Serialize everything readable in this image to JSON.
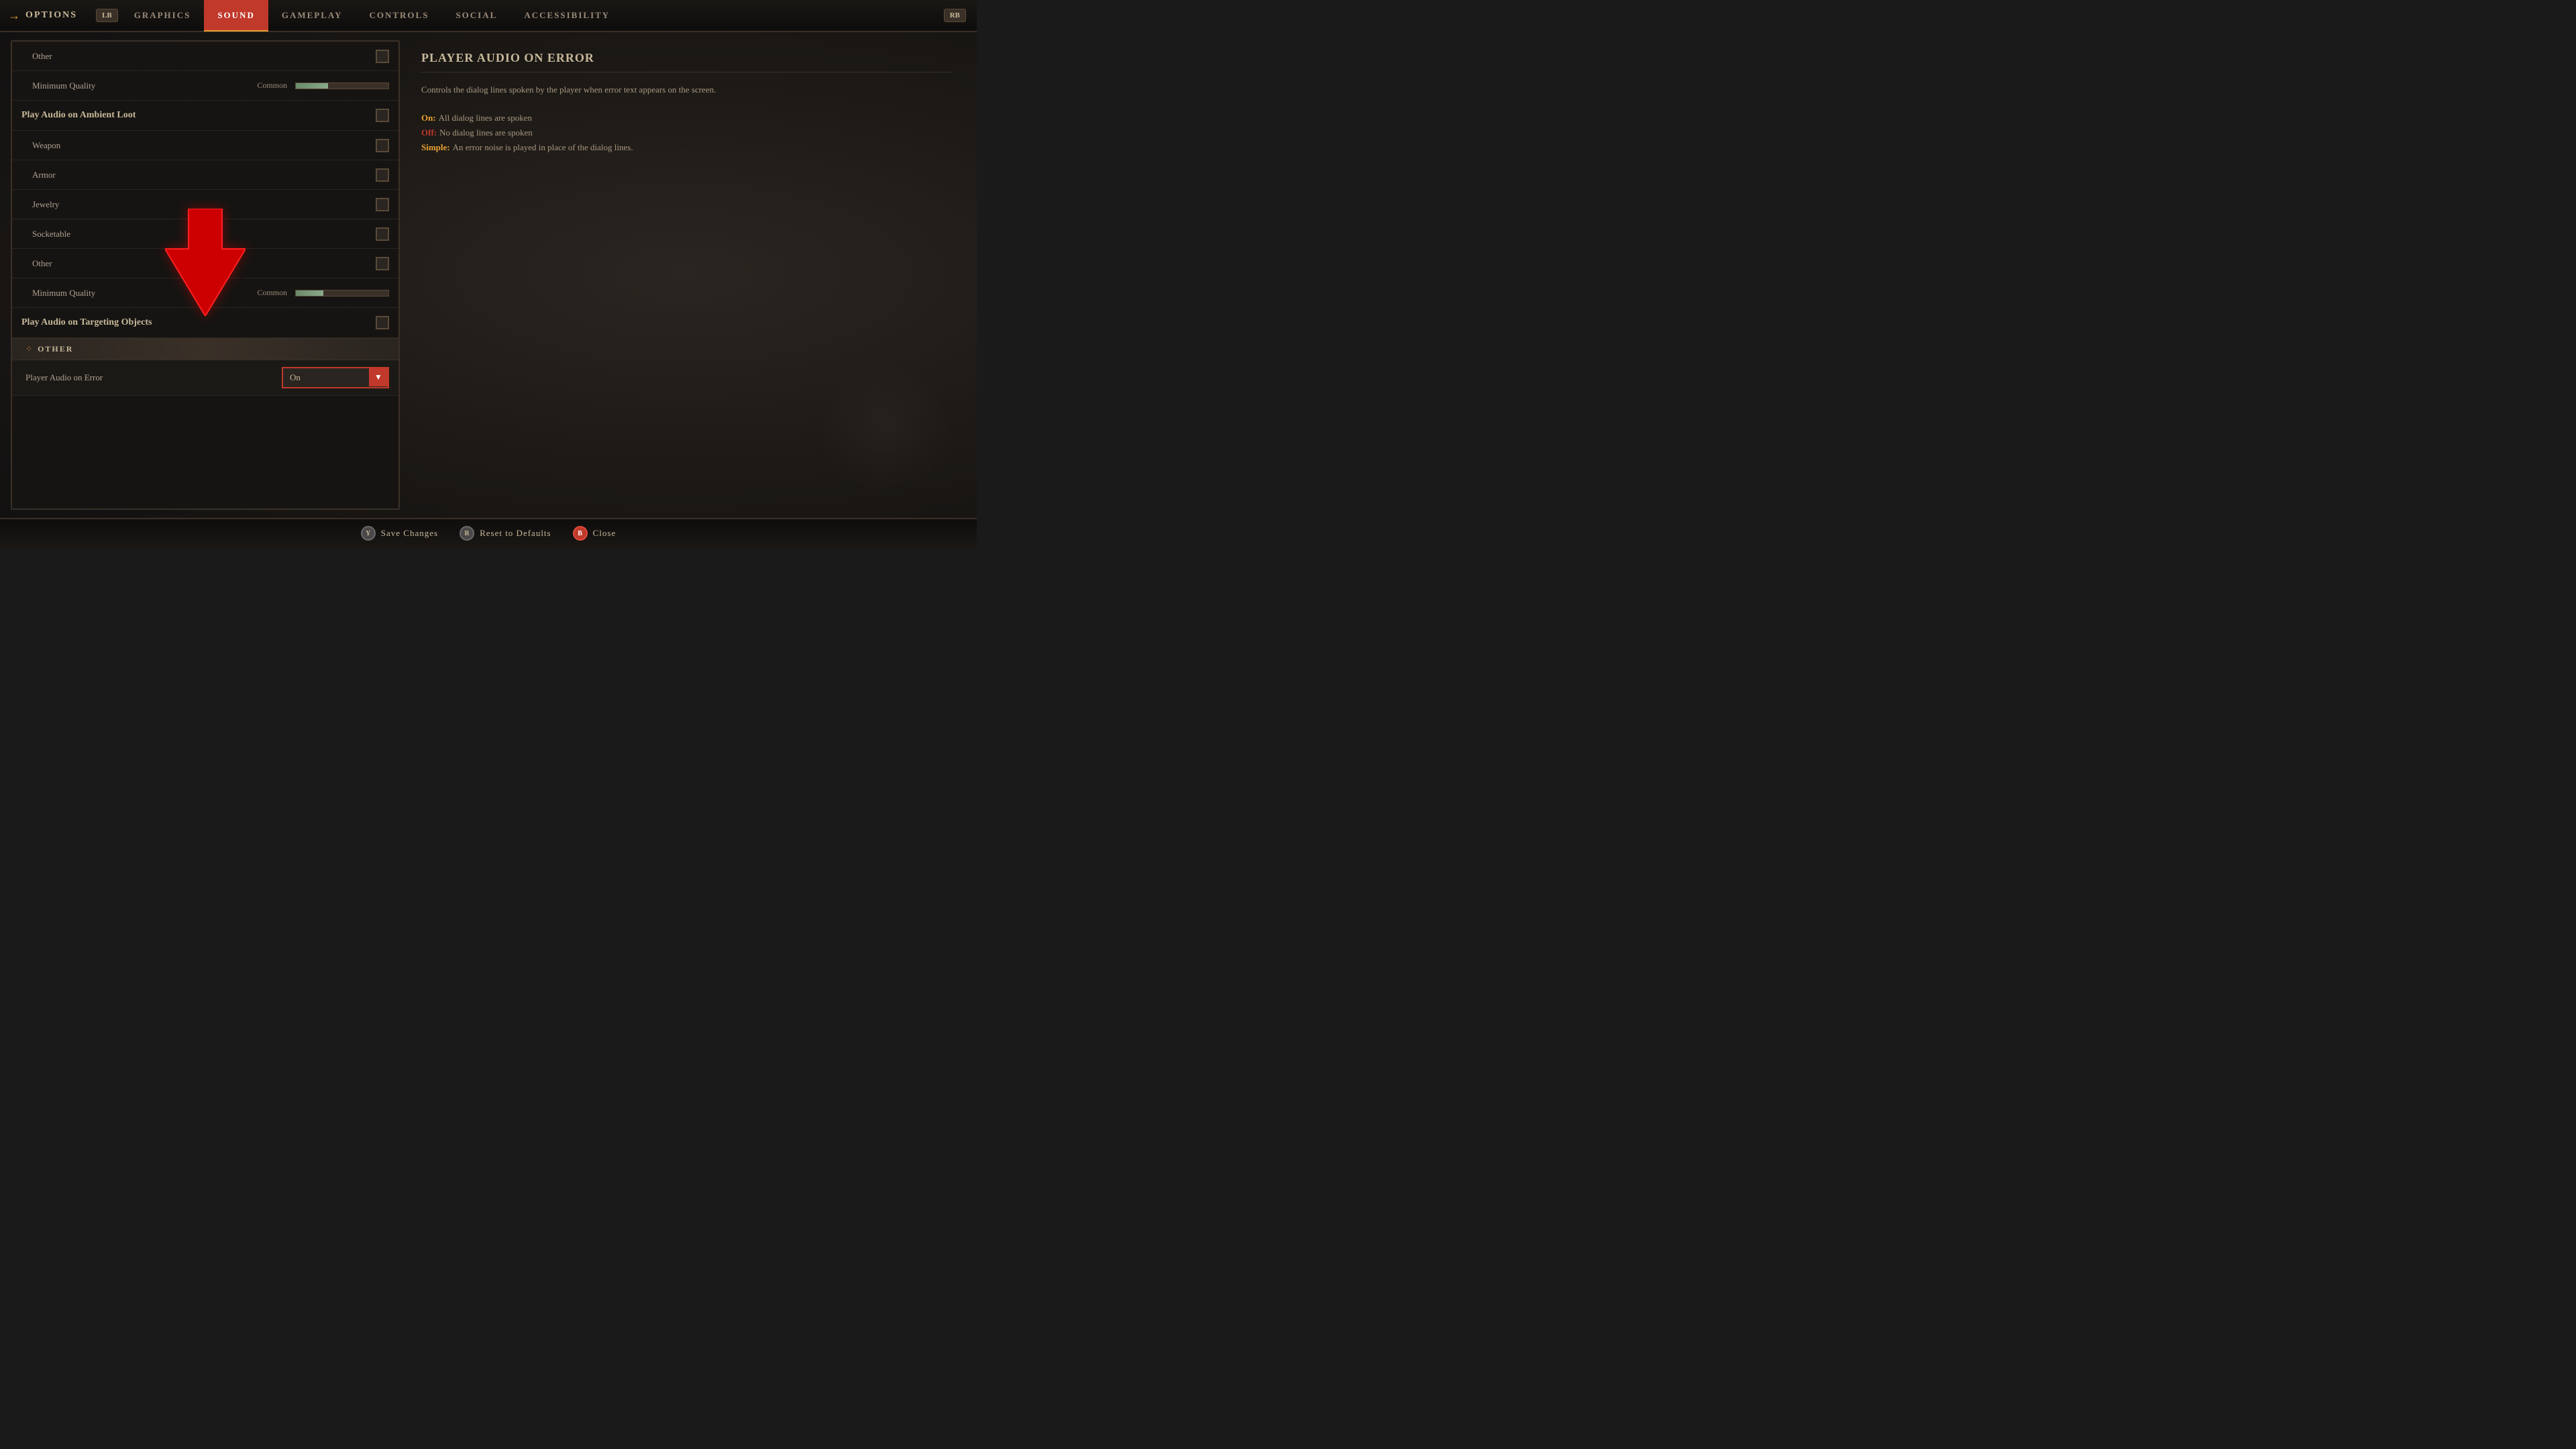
{
  "nav": {
    "logo_arrow": "→",
    "logo_text": "OPTIONS",
    "lb_label": "LB",
    "rb_label": "RB",
    "tabs": [
      {
        "id": "graphics",
        "label": "GRAPHICS",
        "active": false
      },
      {
        "id": "sound",
        "label": "SOUND",
        "active": true
      },
      {
        "id": "gameplay",
        "label": "GAMEPLAY",
        "active": false
      },
      {
        "id": "controls",
        "label": "CONTROLS",
        "active": false
      },
      {
        "id": "social",
        "label": "SOCIAL",
        "active": false
      },
      {
        "id": "accessibility",
        "label": "ACCESSIBILITY",
        "active": false
      }
    ]
  },
  "settings": {
    "items": [
      {
        "type": "item-with-checkbox",
        "label": "Other",
        "indent": true
      },
      {
        "type": "item-with-slider",
        "label": "Minimum Quality",
        "slider_label": "Common",
        "indent": true
      },
      {
        "type": "group-header",
        "label": "Play Audio on Ambient Loot"
      },
      {
        "type": "item-with-checkbox",
        "label": "Weapon",
        "indent": true
      },
      {
        "type": "item-with-checkbox",
        "label": "Armor",
        "indent": true
      },
      {
        "type": "item-with-checkbox",
        "label": "Jewelry",
        "indent": true
      },
      {
        "type": "item-with-checkbox",
        "label": "Socketable",
        "indent": true
      },
      {
        "type": "item-with-checkbox",
        "label": "Other",
        "indent": true
      },
      {
        "type": "item-with-slider",
        "label": "Minimum Quality",
        "slider_label": "Common",
        "indent": true
      },
      {
        "type": "group-header",
        "label": "Play Audio on Targeting Objects"
      },
      {
        "type": "section-divider",
        "label": "OTHER"
      },
      {
        "type": "dropdown",
        "label": "Player Audio on Error",
        "value": "On"
      }
    ]
  },
  "description": {
    "title": "PLAYER AUDIO ON ERROR",
    "body": "Controls the dialog lines spoken by the player when error text appears on the screen.",
    "options": [
      {
        "key": "On:",
        "key_color": "orange",
        "text": "All dialog lines are spoken"
      },
      {
        "key": "Off:",
        "key_color": "red",
        "text": "No dialog lines are spoken"
      },
      {
        "key": "Simple:",
        "key_color": "orange",
        "text": "An error noise is played in place of the dialog lines."
      }
    ]
  },
  "bottom_bar": {
    "save": {
      "btn": "Y",
      "label": "Save Changes"
    },
    "reset": {
      "btn": "R",
      "label": "Reset to Defaults"
    },
    "close": {
      "btn": "B",
      "label": "Close",
      "red": true
    }
  }
}
